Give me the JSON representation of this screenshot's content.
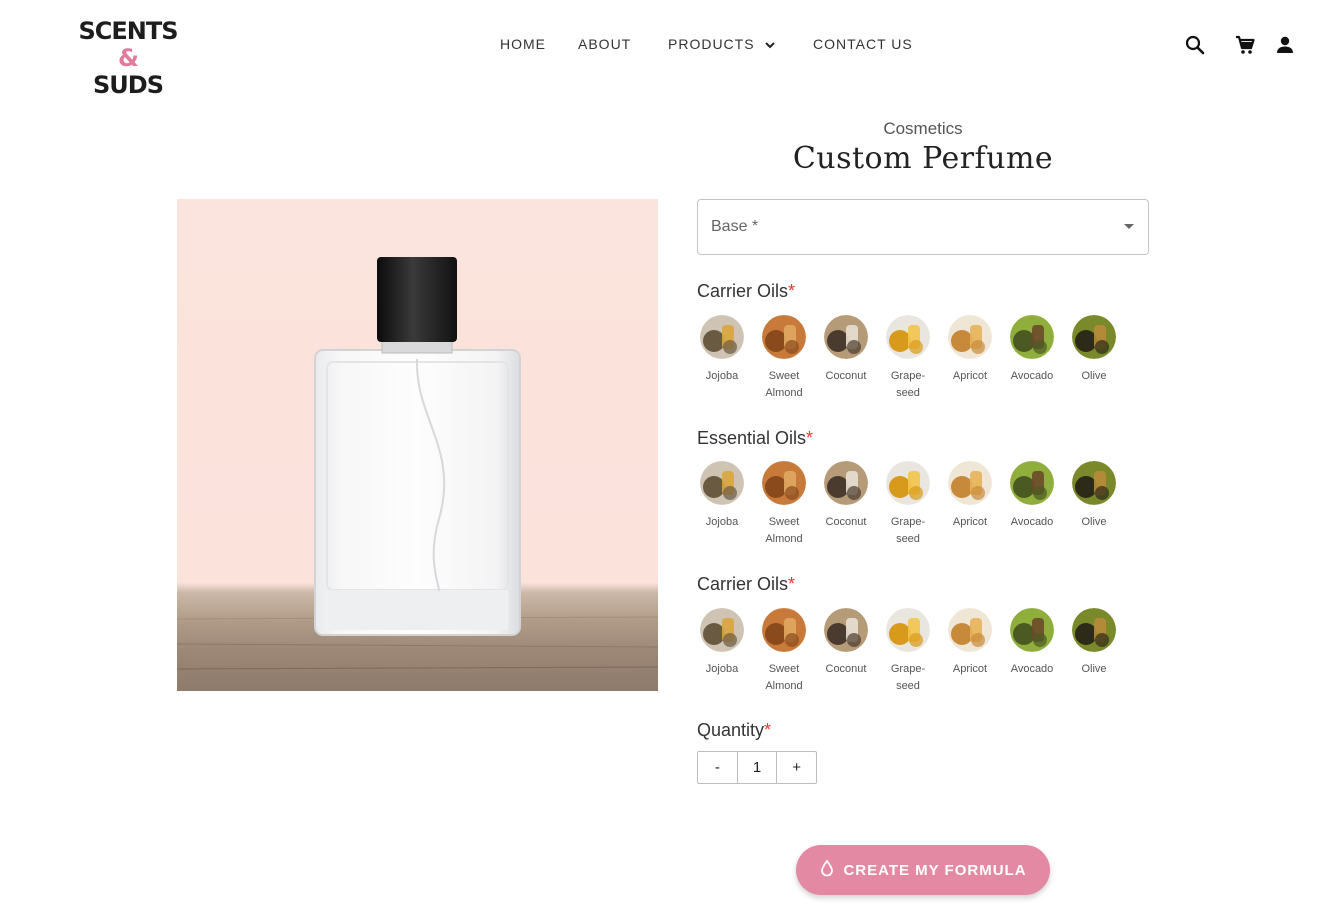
{
  "header": {
    "logo": {
      "line1": "SCENTS",
      "amp": "&",
      "line2": "SUDS"
    },
    "nav": [
      {
        "label": "HOME"
      },
      {
        "label": "ABOUT"
      },
      {
        "label": "PRODUCTS",
        "has_dropdown": true
      },
      {
        "label": "CONTACT US"
      }
    ],
    "icons": [
      "search-icon",
      "cart-icon",
      "account-icon"
    ]
  },
  "product": {
    "category": "Cosmetics",
    "title": "Custom Perfume",
    "base_select": {
      "label": "Base *",
      "value": ""
    },
    "sections": [
      {
        "title": "Carrier Oils",
        "required_mark": "*"
      },
      {
        "title": "Essential Oils",
        "required_mark": "*"
      },
      {
        "title": "Carrier Oils",
        "required_mark": "*"
      }
    ],
    "oils": [
      {
        "line1": "Jojoba",
        "line2": "",
        "icon": "jojoba-oil-icon"
      },
      {
        "line1": "Sweet",
        "line2": "Almond",
        "icon": "sweet-almond-oil-icon"
      },
      {
        "line1": "Coconut",
        "line2": "",
        "icon": "coconut-oil-icon"
      },
      {
        "line1": "Grape-",
        "line2": "seed",
        "icon": "grapeseed-oil-icon"
      },
      {
        "line1": "Apricot",
        "line2": "",
        "icon": "apricot-oil-icon"
      },
      {
        "line1": "Avocado",
        "line2": "",
        "icon": "avocado-oil-icon"
      },
      {
        "line1": "Olive",
        "line2": "",
        "icon": "olive-oil-icon"
      }
    ],
    "quantity": {
      "label": "Quantity",
      "required_mark": "*",
      "minus": "-",
      "value": "1",
      "plus": "+"
    },
    "cta": {
      "label": "CREATE MY FORMULA",
      "icon": "droplet-icon"
    }
  },
  "colors": {
    "accent": "#e389a3",
    "logo_accent": "#e07b9c",
    "required": "#e53935",
    "image_bg": "#fbe4dd"
  }
}
